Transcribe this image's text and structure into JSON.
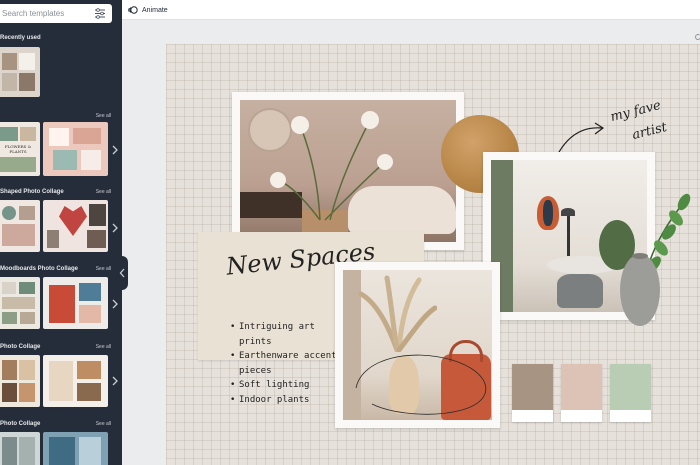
{
  "sidebar": {
    "search": {
      "placeholder": "Search templates"
    },
    "sections": [
      {
        "label": "Recently used",
        "see_all": ""
      },
      {
        "label": "",
        "see_all": "See all"
      },
      {
        "label": "Shaped Photo Collage",
        "see_all": "See all"
      },
      {
        "label": "Moodboards Photo Collage",
        "see_all": "See all"
      },
      {
        "label": "Photo Collage",
        "see_all": "See all"
      },
      {
        "label": "Photo Collage",
        "see_all": "See all"
      }
    ],
    "thumb_text": {
      "plants": "FLOWERS & PLANTS"
    }
  },
  "topbar": {
    "animate_label": "Animate"
  },
  "design": {
    "note_title": "New Spaces",
    "bullets": [
      "Intriguing art prints",
      "Earthenware accent pieces",
      "Soft lighting",
      "Indoor plants"
    ],
    "script_line1": "my fave",
    "script_line2": "artist",
    "swatches": [
      "#a89482",
      "#ddc3b6",
      "#b9cdb4"
    ]
  },
  "colors": {
    "sidebar_bg": "#262d3a",
    "canvas_bg": "#e6e1db",
    "accent_bag": "#c6593a"
  }
}
